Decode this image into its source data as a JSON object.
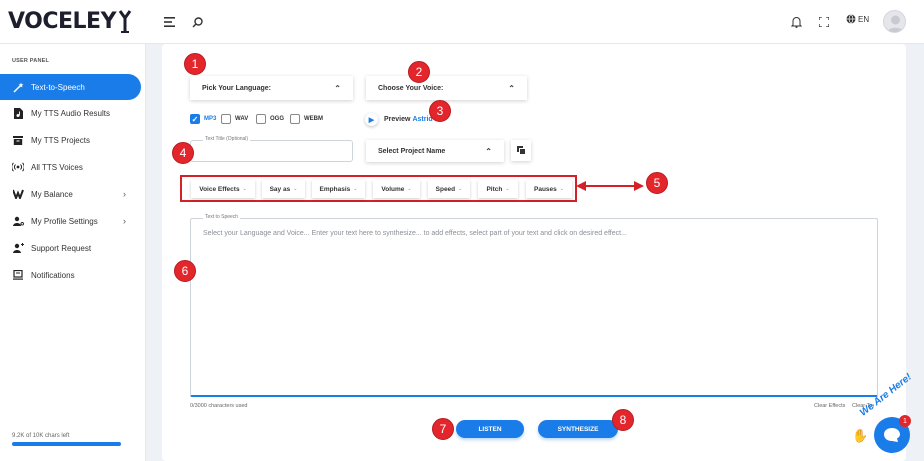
{
  "brand": {
    "logo_text_left": "VO",
    "logo_text_right": "CELEY"
  },
  "header": {
    "language": "EN"
  },
  "sidebar": {
    "section_label": "USER PANEL",
    "items": [
      {
        "label": "Text-to-Speech",
        "icon": "magic-wand-icon",
        "active": true
      },
      {
        "label": "My TTS Audio Results",
        "icon": "file-audio-icon"
      },
      {
        "label": "My TTS Projects",
        "icon": "folder-icon"
      },
      {
        "label": "All TTS Voices",
        "icon": "broadcast-icon"
      },
      {
        "label": "My Balance",
        "icon": "wallet-icon",
        "has_submenu": true
      },
      {
        "label": "My Profile Settings",
        "icon": "user-settings-icon",
        "has_submenu": true
      },
      {
        "label": "Support Request",
        "icon": "support-icon"
      },
      {
        "label": "Notifications",
        "icon": "notification-icon"
      }
    ],
    "chars_left": "9.2K of 10K chars left",
    "chars_progress": 0.92
  },
  "form": {
    "language_select": "Pick Your Language:",
    "voice_select": "Choose Your Voice:",
    "formats": [
      {
        "label": "MP3",
        "checked": true
      },
      {
        "label": "WAV",
        "checked": false
      },
      {
        "label": "OGG",
        "checked": false
      },
      {
        "label": "WEBM",
        "checked": false
      }
    ],
    "preview_label": "Preview",
    "preview_voice": "Astrid",
    "title_legend": "Text Title (Optional)",
    "project_select": "Select Project Name",
    "effects": [
      "Voice Effects",
      "Say as",
      "Emphasis",
      "Volume",
      "Speed",
      "Pitch",
      "Pauses"
    ],
    "tts_legend": "Text to Speech",
    "tts_placeholder": "Select your Language and Voice... Enter your text here to synthesize... to add effects, select part of your text and click on desired effect...",
    "counter": "0/3000 characters used",
    "clear_effects": "Clear Effects",
    "clear_text": "Clear Text",
    "listen_label": "LISTEN",
    "synthesize_label": "SYNTHESIZE"
  },
  "annotations": [
    "1",
    "2",
    "3",
    "4",
    "5",
    "6",
    "7",
    "8"
  ],
  "chat": {
    "tagline": "We Are Here!",
    "badge": "1"
  },
  "colors": {
    "accent": "#1a7ce8",
    "marker": "#e3262b"
  }
}
